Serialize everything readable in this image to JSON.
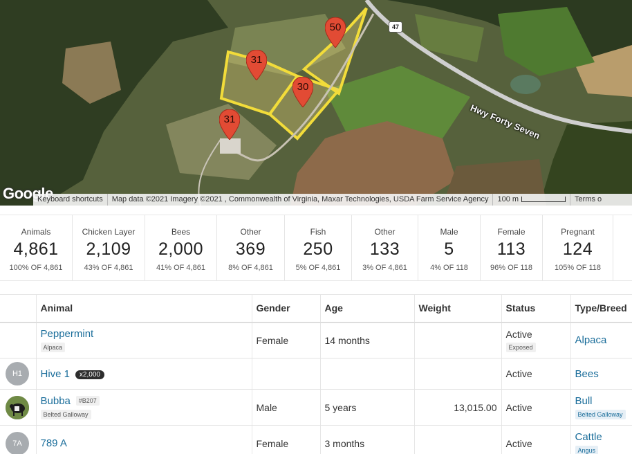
{
  "map": {
    "markers": [
      {
        "label": "50",
        "color": "#e24b34"
      },
      {
        "label": "31",
        "color": "#e24b34"
      },
      {
        "label": "30",
        "color": "#e24b34"
      },
      {
        "label": "31",
        "color": "#e24b34"
      }
    ],
    "road_label": "Hwy Forty Seven",
    "route_shield": "47",
    "google_logo": "Google",
    "footer": {
      "keyboard": "Keyboard shortcuts",
      "attribution": "Map data ©2021 Imagery ©2021 , Commonwealth of Virginia, Maxar Technologies, USDA Farm Service Agency",
      "scale": "100 m",
      "terms": "Terms o"
    },
    "field_outline_color": "#f2dc3a"
  },
  "stats": [
    {
      "label": "Animals",
      "value": "4,861",
      "sub": "100% OF 4,861"
    },
    {
      "label": "Chicken Layer",
      "value": "2,109",
      "sub": "43% OF 4,861"
    },
    {
      "label": "Bees",
      "value": "2,000",
      "sub": "41% OF 4,861"
    },
    {
      "label": "Other",
      "value": "369",
      "sub": "8% OF 4,861"
    },
    {
      "label": "Fish",
      "value": "250",
      "sub": "5% OF 4,861"
    },
    {
      "label": "Other",
      "value": "133",
      "sub": "3% OF 4,861"
    },
    {
      "label": "Male",
      "value": "5",
      "sub": "4% OF 118"
    },
    {
      "label": "Female",
      "value": "113",
      "sub": "96% OF 118"
    },
    {
      "label": "Pregnant",
      "value": "124",
      "sub": "105% OF 118"
    }
  ],
  "table": {
    "headers": [
      "",
      "Animal",
      "Gender",
      "Age",
      "Weight",
      "Status",
      "Type/Breed"
    ],
    "rows": [
      {
        "avatar": "",
        "name": "Peppermint",
        "tag": "Alpaca",
        "id_tag": "",
        "count": "",
        "gender": "Female",
        "age": "14 months",
        "weight": "",
        "status": "Active",
        "status_tag": "Exposed",
        "type": "Alpaca",
        "breed": ""
      },
      {
        "avatar": "H1",
        "name": "Hive 1",
        "tag": "",
        "id_tag": "",
        "count": "x2,000",
        "gender": "",
        "age": "",
        "weight": "",
        "status": "Active",
        "status_tag": "",
        "type": "Bees",
        "breed": ""
      },
      {
        "avatar": "photo",
        "name": "Bubba",
        "tag": "Belted Galloway",
        "id_tag": "#B207",
        "count": "",
        "gender": "Male",
        "age": "5 years",
        "weight": "13,015.00",
        "status": "Active",
        "status_tag": "",
        "type": "Bull",
        "breed": "Belted Galloway"
      },
      {
        "avatar": "7A",
        "name": "789 A",
        "tag": "",
        "id_tag": "",
        "count": "",
        "gender": "Female",
        "age": "3 months",
        "weight": "",
        "status": "Active",
        "status_tag": "",
        "type": "Cattle",
        "breed": "Angus"
      }
    ]
  },
  "colors": {
    "link": "#1a6d9a",
    "marker": "#e24b34",
    "field_outline": "#f2dc3a"
  }
}
